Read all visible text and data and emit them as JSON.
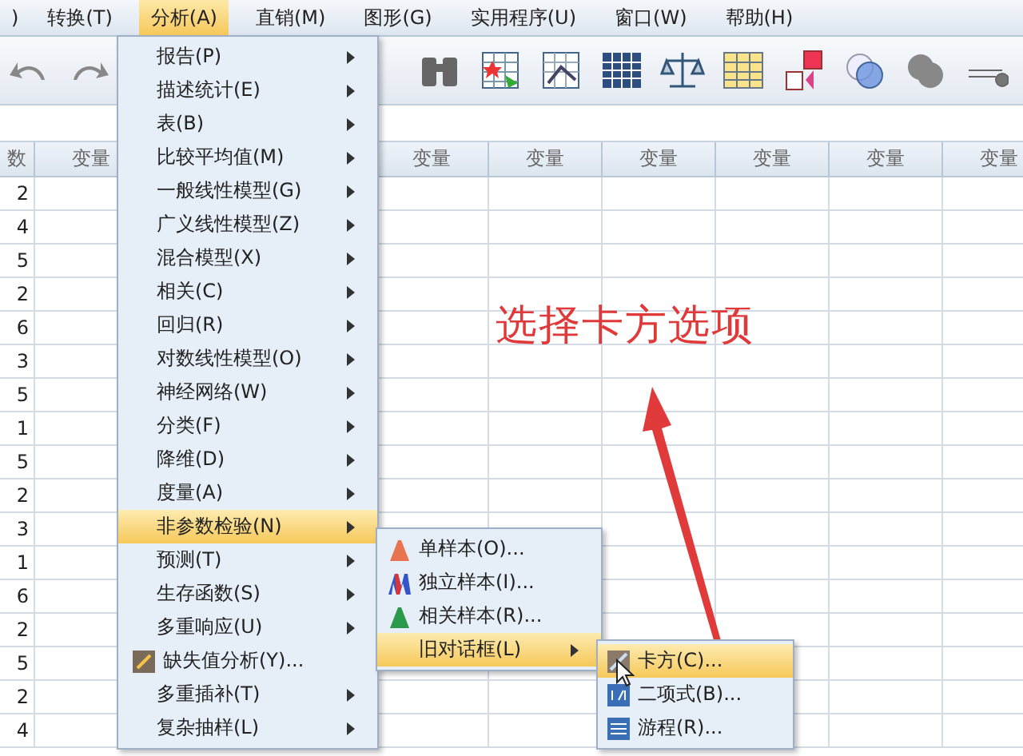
{
  "menubar": [
    {
      "label": ")",
      "selected": false
    },
    {
      "label": "转换(T)",
      "selected": false
    },
    {
      "label": "分析(A)",
      "selected": true
    },
    {
      "label": "直销(M)",
      "selected": false
    },
    {
      "label": "图形(G)",
      "selected": false
    },
    {
      "label": "实用程序(U)",
      "selected": false
    },
    {
      "label": "窗口(W)",
      "selected": false
    },
    {
      "label": "帮助(H)",
      "selected": false
    }
  ],
  "table": {
    "columns": [
      "数",
      "变量",
      "变量",
      "变量",
      "变量",
      "变量",
      "变量",
      "变量"
    ],
    "rows": [
      "2",
      "4",
      "5",
      "2",
      "6",
      "3",
      "5",
      "1",
      "5",
      "2",
      "3",
      "1",
      "6",
      "2",
      "5",
      "2",
      "4"
    ]
  },
  "analyze_menu": [
    {
      "label": "报告(P)",
      "kind": "submenu",
      "selected": false
    },
    {
      "label": "描述统计(E)",
      "kind": "submenu",
      "selected": false
    },
    {
      "label": "表(B)",
      "kind": "submenu",
      "selected": false
    },
    {
      "label": "比较平均值(M)",
      "kind": "submenu",
      "selected": false
    },
    {
      "label": "一般线性模型(G)",
      "kind": "submenu",
      "selected": false
    },
    {
      "label": "广义线性模型(Z)",
      "kind": "submenu",
      "selected": false
    },
    {
      "label": "混合模型(X)",
      "kind": "submenu",
      "selected": false
    },
    {
      "label": "相关(C)",
      "kind": "submenu",
      "selected": false
    },
    {
      "label": "回归(R)",
      "kind": "submenu",
      "selected": false
    },
    {
      "label": "对数线性模型(O)",
      "kind": "submenu",
      "selected": false
    },
    {
      "label": "神经网络(W)",
      "kind": "submenu",
      "selected": false
    },
    {
      "label": "分类(F)",
      "kind": "submenu",
      "selected": false
    },
    {
      "label": "降维(D)",
      "kind": "submenu",
      "selected": false
    },
    {
      "label": "度量(A)",
      "kind": "submenu",
      "selected": false
    },
    {
      "label": "非参数检验(N)",
      "kind": "submenu",
      "selected": true
    },
    {
      "label": "预测(T)",
      "kind": "submenu",
      "selected": false
    },
    {
      "label": "生存函数(S)",
      "kind": "submenu",
      "selected": false
    },
    {
      "label": "多重响应(U)",
      "kind": "submenu",
      "selected": false
    },
    {
      "label": "缺失值分析(Y)...",
      "kind": "command",
      "selected": false
    },
    {
      "label": "多重插补(T)",
      "kind": "submenu",
      "selected": false
    },
    {
      "label": "复杂抽样(L)",
      "kind": "submenu",
      "selected": false
    }
  ],
  "nonparametric_menu": [
    {
      "label": "单样本(O)...",
      "kind": "command",
      "selected": false
    },
    {
      "label": "独立样本(I)...",
      "kind": "command",
      "selected": false
    },
    {
      "label": "相关样本(R)...",
      "kind": "command",
      "selected": false
    },
    {
      "label": "旧对话框(L)",
      "kind": "submenu",
      "selected": true
    }
  ],
  "legacy_dialogs_menu": [
    {
      "label": "卡方(C)...",
      "selected": true
    },
    {
      "label": "二项式(B)...",
      "selected": false
    },
    {
      "label": "游程(R)...",
      "selected": false
    }
  ],
  "annotation": {
    "text": "选择卡方选项"
  }
}
